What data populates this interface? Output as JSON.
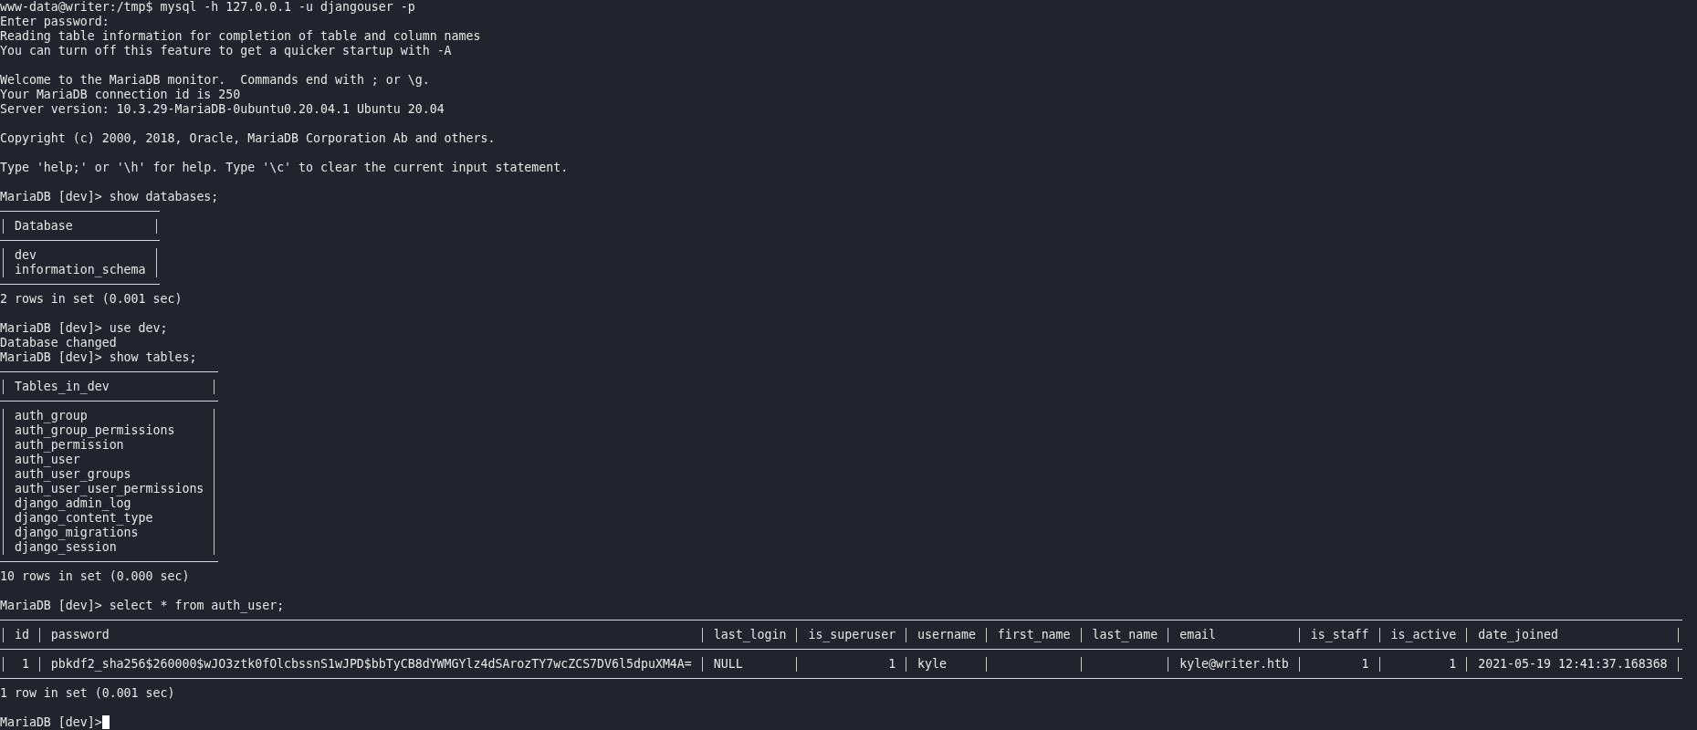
{
  "terminal": {
    "blocks": [
      {
        "kind": "text",
        "text": "www-data@writer:/tmp$ mysql -h 127.0.0.1 -u djangouser -p"
      },
      {
        "kind": "text",
        "text": "Enter password:"
      },
      {
        "kind": "text",
        "text": "Reading table information for completion of table and column names"
      },
      {
        "kind": "text",
        "text": "You can turn off this feature to get a quicker startup with -A"
      },
      {
        "kind": "gap"
      },
      {
        "kind": "text",
        "text": "Welcome to the MariaDB monitor.  Commands end with ; or \\g."
      },
      {
        "kind": "text",
        "text": "Your MariaDB connection id is 250"
      },
      {
        "kind": "text",
        "text": "Server version: 10.3.29-MariaDB-0ubuntu0.20.04.1 Ubuntu 20.04"
      },
      {
        "kind": "gap"
      },
      {
        "kind": "text",
        "text": "Copyright (c) 2000, 2018, Oracle, MariaDB Corporation Ab and others."
      },
      {
        "kind": "gap"
      },
      {
        "kind": "text",
        "text": "Type 'help;' or '\\h' for help. Type '\\c' to clear the current input statement."
      },
      {
        "kind": "gap"
      },
      {
        "kind": "text",
        "text": "MariaDB [dev]> show databases;"
      },
      {
        "kind": "table",
        "columns": [
          {
            "label": "Database",
            "right_aligned": false
          }
        ],
        "rows": [
          [
            "dev"
          ],
          [
            "information_schema"
          ]
        ]
      },
      {
        "kind": "text",
        "text": "2 rows in set (0.001 sec)"
      },
      {
        "kind": "gap"
      },
      {
        "kind": "text",
        "text": "MariaDB [dev]> use dev;"
      },
      {
        "kind": "text",
        "text": "Database changed"
      },
      {
        "kind": "text",
        "text": "MariaDB [dev]> show tables;"
      },
      {
        "kind": "table",
        "columns": [
          {
            "label": "Tables_in_dev",
            "right_aligned": false
          }
        ],
        "rows": [
          [
            "auth_group"
          ],
          [
            "auth_group_permissions"
          ],
          [
            "auth_permission"
          ],
          [
            "auth_user"
          ],
          [
            "auth_user_groups"
          ],
          [
            "auth_user_user_permissions"
          ],
          [
            "django_admin_log"
          ],
          [
            "django_content_type"
          ],
          [
            "django_migrations"
          ],
          [
            "django_session"
          ]
        ]
      },
      {
        "kind": "text",
        "text": "10 rows in set (0.000 sec)"
      },
      {
        "kind": "gap"
      },
      {
        "kind": "text",
        "text": "MariaDB [dev]> select * from auth_user;"
      },
      {
        "kind": "table",
        "columns": [
          {
            "label": "id",
            "right_aligned": true
          },
          {
            "label": "password"
          },
          {
            "label": "last_login",
            "right_aligned": false
          },
          {
            "label": "is_superuser",
            "right_aligned": true
          },
          {
            "label": "username",
            "right_aligned": false
          },
          {
            "label": "first_name"
          },
          {
            "label": "last_name"
          },
          {
            "label": "email"
          },
          {
            "label": "is_staff",
            "right_aligned": true
          },
          {
            "label": "is_active",
            "right_aligned": true
          },
          {
            "label": "date_joined"
          }
        ],
        "rows": [
          [
            "1",
            "pbkdf2_sha256$260000$wJO3ztk0fOlcbssnS1wJPD$bbTyCB8dYWMGYlz4dSArozTY7wcZCS7DV6l5dpuXM4A=",
            "NULL",
            "1",
            "kyle",
            null,
            null,
            "kyle@writer.htb",
            "1",
            "1",
            "2021-05-19 12:41:37.168368"
          ]
        ]
      },
      {
        "kind": "text",
        "text": "1 row in set (0.001 sec)"
      },
      {
        "kind": "gap"
      },
      {
        "kind": "prompt",
        "text": "MariaDB [dev]>"
      }
    ]
  }
}
